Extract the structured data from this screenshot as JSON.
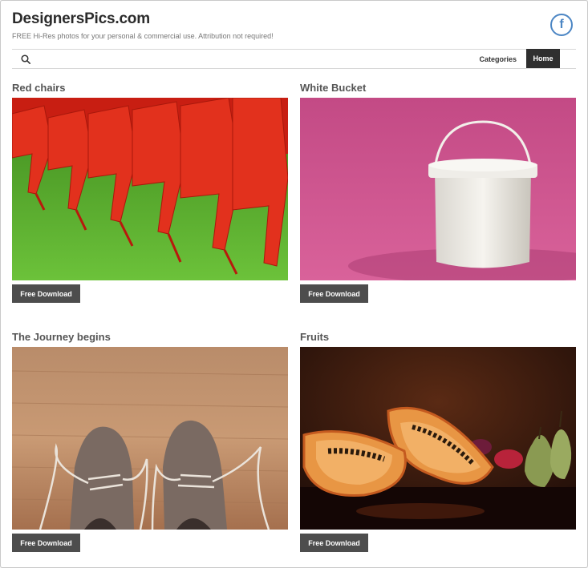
{
  "header": {
    "title": "DesignersPics.com",
    "tagline": "FREE Hi-Res photos for your personal & commercial use. Attribution not required!",
    "facebook_glyph": "f"
  },
  "nav": {
    "categories": "Categories",
    "home": "Home"
  },
  "cards": [
    {
      "title": "Red chairs",
      "button": "Free Download"
    },
    {
      "title": "White Bucket",
      "button": "Free Download"
    },
    {
      "title": "The Journey begins",
      "button": "Free Download"
    },
    {
      "title": "Fruits",
      "button": "Free Download"
    }
  ],
  "colors": {
    "facebook": "#4c86c4",
    "nav_active": "#2f2f2f",
    "button": "#4d4d4d"
  }
}
